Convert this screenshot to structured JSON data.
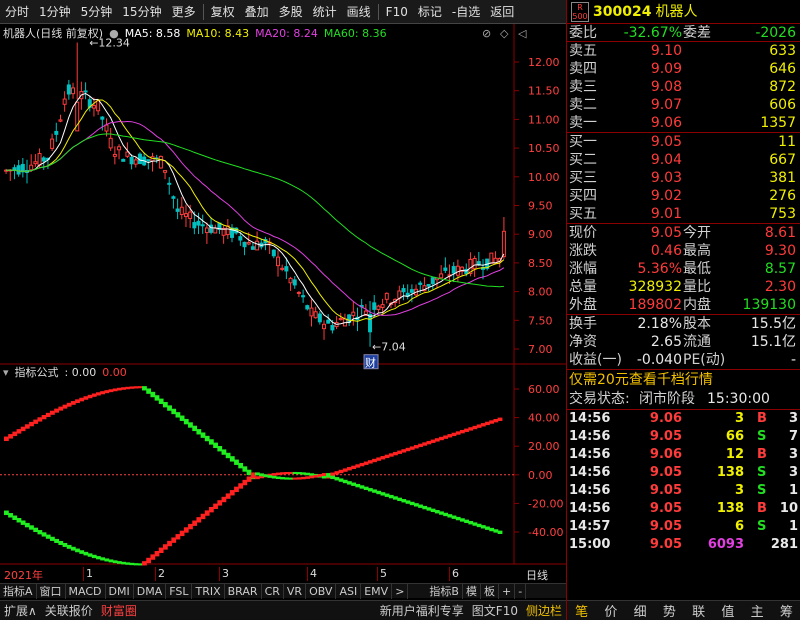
{
  "toolbar": {
    "items": [
      "分时",
      "1分钟",
      "5分钟",
      "15分钟",
      "更多",
      "复权",
      "叠加",
      "多股",
      "统计",
      "画线",
      "F10",
      "标记",
      "-自选",
      "返回"
    ]
  },
  "chart": {
    "name": "机器人(日线 前复权)",
    "ma5": "MA5: 8.58",
    "ma10": "MA10: 8.43",
    "ma20": "MA20: 8.24",
    "ma60": "MA60: 8.36",
    "high_label": "12.34",
    "low_label": "7.04",
    "event_marker": "财",
    "y_ticks": [
      "12.00",
      "11.50",
      "11.00",
      "10.50",
      "10.00",
      "9.50",
      "9.00",
      "8.50",
      "8.00",
      "7.50",
      "7.00"
    ],
    "colors": {
      "up": "#ff3b3b",
      "down": "#00c0c0",
      "ma5": "#ffffff",
      "ma10": "#f0f000",
      "ma20": "#e040e0",
      "ma60": "#22dd22"
    }
  },
  "indicator": {
    "title": "指标公式",
    "value1": ": 0.00",
    "value2": "0.00",
    "y_ticks": [
      "60.00",
      "40.00",
      "20.00",
      "0.00",
      "-20.00",
      "-40.00"
    ]
  },
  "date_axis": {
    "labels": [
      "2021年",
      "1",
      "2",
      "3",
      "4",
      "5",
      "6"
    ],
    "period": "日线"
  },
  "tabs": [
    "指标A",
    "窗口",
    "MACD",
    "DMI",
    "DMA",
    "FSL",
    "TRIX",
    "BRAR",
    "CR",
    "VR",
    "OBV",
    "ASI",
    "EMV",
    ">",
    "指标B",
    "模",
    "板",
    "+",
    "-"
  ],
  "bottom": {
    "left": [
      "扩展∧",
      "关联报价",
      "财富圈"
    ],
    "right": [
      "新用户福利专享",
      "图文F10",
      "侧边栏"
    ]
  },
  "quote": {
    "badge_top": "R",
    "badge_bottom": "500",
    "code": "300024",
    "name": "机器人",
    "webi_label": "委比",
    "webi": "-32.67%",
    "weicha_label": "委差",
    "weicha": "-2026",
    "asks": [
      {
        "label": "卖五",
        "price": "9.10",
        "vol": "633"
      },
      {
        "label": "卖四",
        "price": "9.09",
        "vol": "646"
      },
      {
        "label": "卖三",
        "price": "9.08",
        "vol": "872"
      },
      {
        "label": "卖二",
        "price": "9.07",
        "vol": "606"
      },
      {
        "label": "卖一",
        "price": "9.06",
        "vol": "1357"
      }
    ],
    "bids": [
      {
        "label": "买一",
        "price": "9.05",
        "vol": "11"
      },
      {
        "label": "买二",
        "price": "9.04",
        "vol": "667"
      },
      {
        "label": "买三",
        "price": "9.03",
        "vol": "381"
      },
      {
        "label": "买四",
        "price": "9.02",
        "vol": "276"
      },
      {
        "label": "买五",
        "price": "9.01",
        "vol": "753"
      }
    ],
    "stats": [
      {
        "l1": "现价",
        "v1": "9.05",
        "c1": "red",
        "l2": "今开",
        "v2": "8.61",
        "c2": "red"
      },
      {
        "l1": "涨跌",
        "v1": "0.46",
        "c1": "red",
        "l2": "最高",
        "v2": "9.30",
        "c2": "red"
      },
      {
        "l1": "涨幅",
        "v1": "5.36%",
        "c1": "red",
        "l2": "最低",
        "v2": "8.57",
        "c2": "grn"
      },
      {
        "l1": "总量",
        "v1": "328932",
        "c1": "ylw",
        "l2": "量比",
        "v2": "2.30",
        "c2": "red"
      },
      {
        "l1": "外盘",
        "v1": "189802",
        "c1": "red",
        "l2": "内盘",
        "v2": "139130",
        "c2": "grn"
      }
    ],
    "stats2": [
      {
        "l1": "换手",
        "v1": "2.18%",
        "l2": "股本",
        "v2": "15.5亿"
      },
      {
        "l1": "净资",
        "v1": "2.65",
        "l2": "流通",
        "v2": "15.1亿"
      },
      {
        "l1": "收益(一)",
        "v1": "-0.040",
        "l2": "PE(动)",
        "v2": "-"
      }
    ],
    "promo": "仅需20元查看千档行情",
    "status_label": "交易状态:",
    "status": "闭市阶段",
    "status_time": "15:30:00",
    "ticks": [
      {
        "t": "14:56",
        "p": "9.06",
        "v": "3",
        "s": "B",
        "n": "3"
      },
      {
        "t": "14:56",
        "p": "9.05",
        "v": "66",
        "s": "S",
        "n": "7"
      },
      {
        "t": "14:56",
        "p": "9.06",
        "v": "12",
        "s": "B",
        "n": "3"
      },
      {
        "t": "14:56",
        "p": "9.05",
        "v": "138",
        "s": "S",
        "n": "3"
      },
      {
        "t": "14:56",
        "p": "9.05",
        "v": "3",
        "s": "S",
        "n": "1"
      },
      {
        "t": "14:56",
        "p": "9.05",
        "v": "138",
        "s": "B",
        "n": "10"
      },
      {
        "t": "14:57",
        "p": "9.05",
        "v": "6",
        "s": "S",
        "n": "1"
      },
      {
        "t": "15:00",
        "p": "9.05",
        "v": "6093",
        "s": "",
        "n": "281"
      }
    ],
    "bottom_tabs": [
      "笔",
      "价",
      "细",
      "势",
      "联",
      "值",
      "主",
      "筹"
    ]
  }
}
